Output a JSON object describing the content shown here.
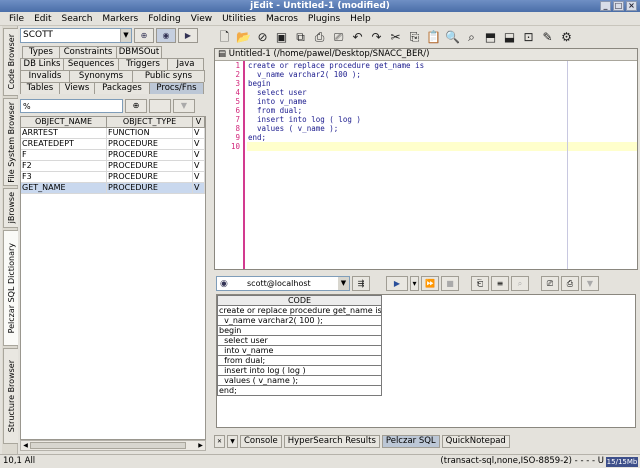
{
  "window": {
    "title": "jEdit - Untitled-1 (modified)"
  },
  "menu": [
    "File",
    "Edit",
    "Search",
    "Markers",
    "Folding",
    "View",
    "Utilities",
    "Macros",
    "Plugins",
    "Help"
  ],
  "dock_tabs": [
    "Code Browser",
    "File System Browser",
    "jBrowse",
    "Pelczar SQL Dictionary",
    "Structure Browser"
  ],
  "schema": {
    "value": "SCOTT"
  },
  "object_tabs": [
    [
      "Types",
      "Constraints",
      "DBMSOut"
    ],
    [
      "DB Links",
      "Sequences",
      "Triggers",
      "Java"
    ],
    [
      "Invalids",
      "Synonyms",
      "Public syns"
    ],
    [
      "Tables",
      "Views",
      "Packages",
      "Procs/Fns"
    ]
  ],
  "filter": {
    "value": "%"
  },
  "objects": {
    "headers": [
      "OBJECT_NAME",
      "OBJECT_TYPE",
      "V"
    ],
    "rows": [
      [
        "ARRTEST",
        "FUNCTION",
        "V"
      ],
      [
        "CREATEDEPT",
        "PROCEDURE",
        "V"
      ],
      [
        "F",
        "PROCEDURE",
        "V"
      ],
      [
        "F2",
        "PROCEDURE",
        "V"
      ],
      [
        "F3",
        "PROCEDURE",
        "V"
      ],
      [
        "GET_NAME",
        "PROCEDURE",
        "V"
      ]
    ]
  },
  "editor": {
    "path": "Untitled-1 (/home/pawel/Desktop/SNACC_BER/)",
    "line_numbers": [
      "1",
      "2",
      "3",
      "4",
      "5",
      "6",
      "7",
      "8",
      "9",
      "10"
    ],
    "lines": [
      "create or replace procedure get_name is",
      "  v_name varchar2( 100 );",
      "begin",
      "  select user",
      "  into v_name",
      "  from dual;",
      "  insert into log ( log )",
      "  values ( v_name );",
      "end;",
      ""
    ]
  },
  "sql": {
    "connection": "scott@localhost",
    "column": "CODE",
    "rows": [
      "create or replace procedure get_name is",
      "  v_name varchar2( 100 );",
      "begin",
      "  select user",
      "  into v_name",
      "  from dual;",
      "  insert into log ( log )",
      "  values ( v_name );",
      "end;"
    ]
  },
  "bottom_tabs": [
    "Console",
    "HyperSearch Results",
    "Pelczar SQL",
    "QuickNotepad"
  ],
  "status": {
    "position": "10,1 All",
    "mode": "(transact-sql,none,ISO-8859-2) - - - - U",
    "memory": "15/15Mb"
  },
  "colors": {
    "gutter_text": "#d2287c",
    "code_text": "#202090",
    "selection": "#c9d8ee",
    "title_bar": "#4a6ea8"
  }
}
